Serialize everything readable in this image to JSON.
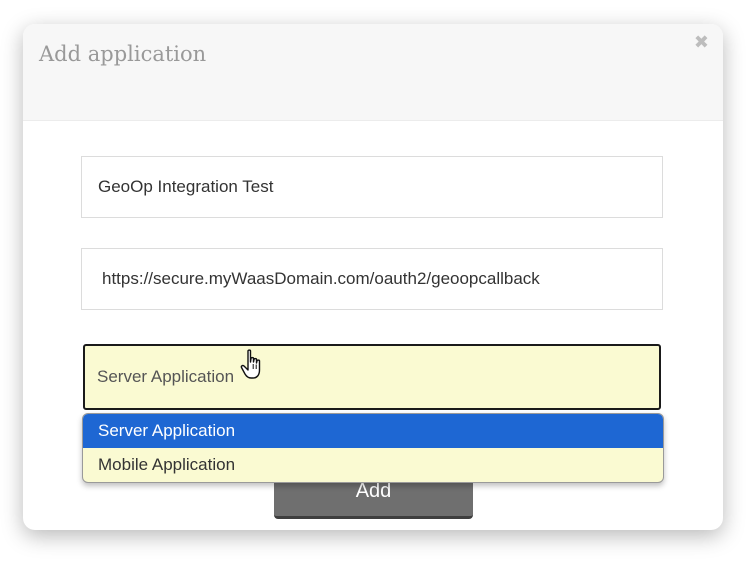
{
  "dialog": {
    "title": "Add application",
    "close_glyph": "✖"
  },
  "form": {
    "name_value": "GeoOp Integration Test",
    "callback_url_value": "https://secure.myWaasDomain.com/oauth2/geoopcallback",
    "app_type": {
      "selected": "Server Application",
      "options": [
        "Server Application",
        "Mobile Application"
      ],
      "highlighted_index": 0
    },
    "add_label": "Add"
  },
  "colors": {
    "select_background": "#fafad2",
    "highlight": "#1e67d3",
    "button": "#6f6f6f"
  },
  "icons": {
    "close": "close-icon",
    "cursor": "hand-pointer-icon"
  }
}
